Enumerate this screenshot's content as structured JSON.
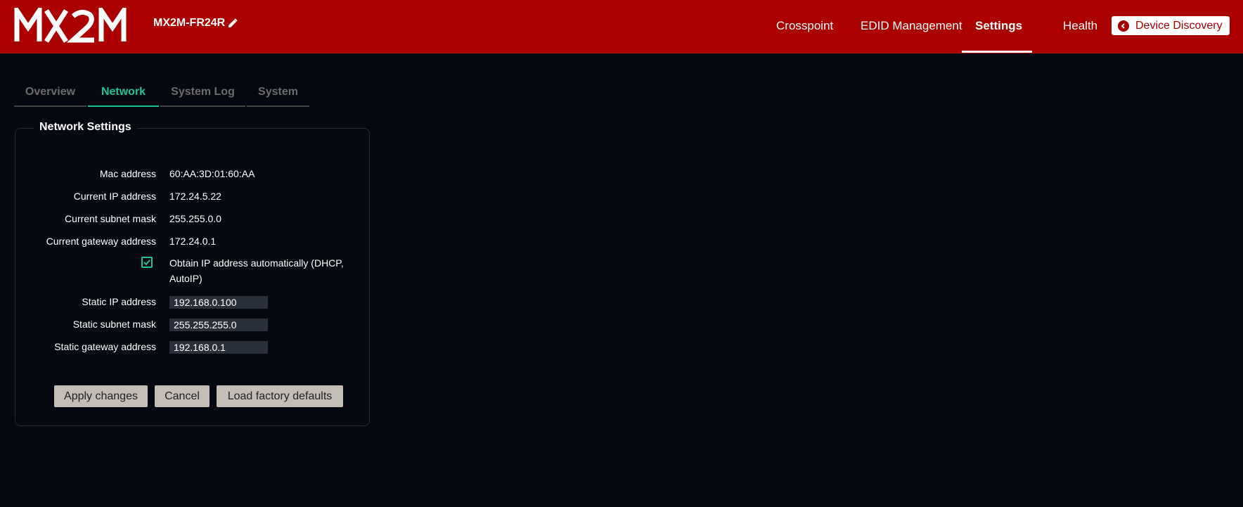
{
  "header": {
    "logo_text": "MX2M",
    "device_name": "MX2M-FR24R",
    "nav": [
      "Crosspoint",
      "EDID Management",
      "Settings",
      "Health"
    ],
    "active_nav": "Settings",
    "discovery_label": "Device Discovery"
  },
  "tabs": [
    "Overview",
    "Network",
    "System Log",
    "System"
  ],
  "active_tab": "Network",
  "panel": {
    "title": "Network Settings",
    "mac_label": "Mac address",
    "mac_value": "60:AA:3D:01:60:AA",
    "ip_label": "Current IP address",
    "ip_value": "172.24.5.22",
    "subnet_label": "Current subnet mask",
    "subnet_value": "255.255.0.0",
    "gateway_label": "Current gateway address",
    "gateway_value": "172.24.0.1",
    "dhcp_label": "Obtain IP address automatically (DHCP, AutoIP)",
    "dhcp_checked": true,
    "static_ip_label": "Static IP address",
    "static_ip_value": "192.168.0.100",
    "static_subnet_label": "Static subnet mask",
    "static_subnet_value": "255.255.255.0",
    "static_gateway_label": "Static gateway address",
    "static_gateway_value": "192.168.0.1"
  },
  "buttons": {
    "apply": "Apply changes",
    "cancel": "Cancel",
    "defaults": "Load factory defaults"
  },
  "colors": {
    "header_bg": "#aa0000",
    "page_bg": "#050810",
    "accent": "#1cc29a",
    "button_bg": "#c4bcb6"
  },
  "icons": {
    "edit": "pencil-icon",
    "back": "chevron-left-circle-icon",
    "checkbox": "checkmark-icon"
  }
}
